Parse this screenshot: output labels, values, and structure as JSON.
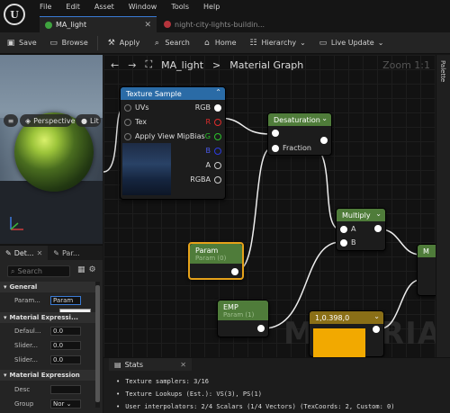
{
  "menu": {
    "items": [
      "File",
      "Edit",
      "Asset",
      "Window",
      "Tools",
      "Help"
    ]
  },
  "tabs": [
    {
      "label": "MA_light",
      "active": true
    },
    {
      "label": "night-city-lights-buildin...",
      "active": false
    }
  ],
  "toolbar": {
    "save": "Save",
    "browse": "Browse",
    "apply": "Apply",
    "search": "Search",
    "home": "Home",
    "hierarchy": "Hierarchy",
    "live_update": "Live Update"
  },
  "viewport": {
    "perspective": "Perspective",
    "lit": "Lit"
  },
  "details": {
    "tab1": "Det...",
    "tab2": "Par...",
    "search_placeholder": "Search",
    "section_general": "General",
    "param_label": "Param...",
    "param_value": "Param",
    "tooltip": "Param",
    "section_material_expr": "Material Expressi...",
    "default_label": "Defaul...",
    "default_value": "0.0",
    "slider1_label": "Slider...",
    "slider1_value": "0.0",
    "slider2_label": "Slider...",
    "slider2_value": "0.0",
    "section_material_expression": "Material Expression",
    "desc_label": "Desc",
    "group_label": "Group",
    "group_value": "Nor"
  },
  "graph": {
    "title": "MA_light",
    "breadcrumb_sep": ">",
    "subtitle": "Material Graph",
    "zoom": "Zoom 1:1",
    "watermark": "MATERIAL"
  },
  "palette": {
    "label": "Palette"
  },
  "nodes": {
    "texture_sample": {
      "title": "Texture Sample",
      "inputs": [
        "UVs",
        "Tex",
        "Apply View MipBias"
      ],
      "outputs": [
        "RGB",
        "R",
        "G",
        "B",
        "A",
        "RGBA"
      ]
    },
    "desaturation": {
      "title": "Desaturation",
      "input": "Fraction"
    },
    "multiply": {
      "title": "Multiply",
      "inputs": [
        "A",
        "B"
      ]
    },
    "param": {
      "title": "Param",
      "sub": "Param (0)"
    },
    "emp": {
      "title": "EMP",
      "sub": "Param (1)"
    },
    "constant": {
      "title": "1,0.398,0"
    },
    "partial": {
      "title": "M"
    }
  },
  "stats": {
    "tab": "Stats",
    "lines": [
      "Texture samplers: 3/16",
      "Texture Lookups (Est.): VS(3), PS(1)",
      "User interpolators: 2/4 Scalars (1/4 Vectors) (TexCoords: 2, Custom: 0)"
    ]
  },
  "colors": {
    "texture_header": "#2a6ba6",
    "green_header": "#4f7c3a",
    "selection": "#e6a21a",
    "constant_color": "#f2a900"
  }
}
